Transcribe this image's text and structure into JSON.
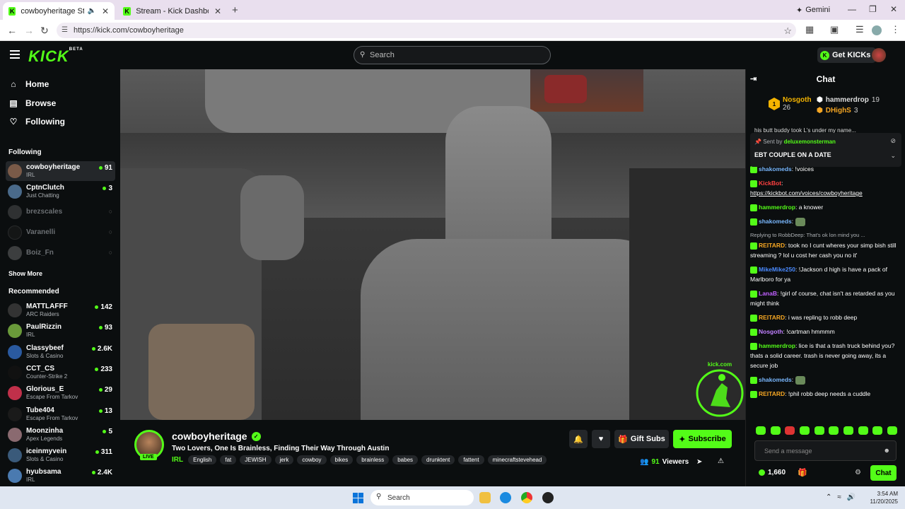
{
  "browser": {
    "tabs": [
      {
        "title": "cowboyheritage Stream - V",
        "active": true,
        "sound_icon": "speaker-icon"
      },
      {
        "title": "Stream - Kick Dashboard",
        "active": false
      }
    ],
    "new_tab": "+",
    "gemini_label": "Gemini",
    "url": "https://kick.com/cowboyheritage"
  },
  "kick": {
    "logo": "KICK",
    "logo_badge": "BETA",
    "search_placeholder": "Search",
    "get_kicks_label": "Get KICKs",
    "accent": "#53fc18"
  },
  "sidebar": {
    "nav": [
      {
        "label": "Home",
        "icon": "home-icon"
      },
      {
        "label": "Browse",
        "icon": "browse-icon"
      },
      {
        "label": "Following",
        "icon": "heart-icon"
      }
    ],
    "following_heading": "Following",
    "following": [
      {
        "name": "cowboyheritage",
        "category": "IRL",
        "viewers": "91",
        "live": true,
        "selected": true,
        "color": "#7a5a48"
      },
      {
        "name": "CptnClutch",
        "category": "Just Chatting",
        "viewers": "3",
        "live": true,
        "color": "#4a6a8a"
      },
      {
        "name": "brezscales",
        "live": false,
        "color": "#666"
      },
      {
        "name": "Varanelli",
        "live": false,
        "color": "#222"
      },
      {
        "name": "Boiz_Fn",
        "live": false,
        "color": "#888"
      }
    ],
    "show_more": "Show More",
    "recommended_heading": "Recommended",
    "recommended": [
      {
        "name": "MATTLAFFF",
        "category": "ARC Raiders",
        "viewers": "142",
        "color": "#333"
      },
      {
        "name": "PaulRizzin",
        "category": "IRL",
        "viewers": "93",
        "color": "#6a9a3a"
      },
      {
        "name": "Classybeef",
        "category": "Slots & Casino",
        "viewers": "2.6K",
        "color": "#2a5aa0"
      },
      {
        "name": "CCT_CS",
        "category": "Counter-Strike 2",
        "viewers": "233",
        "color": "#111"
      },
      {
        "name": "Glorious_E",
        "category": "Escape From Tarkov",
        "viewers": "29",
        "color": "#c0304a"
      },
      {
        "name": "Tube404",
        "category": "Escape From Tarkov",
        "viewers": "13",
        "color": "#1a1a1a"
      },
      {
        "name": "Moonzinha",
        "category": "Apex Legends",
        "viewers": "5",
        "color": "#8a6a70"
      },
      {
        "name": "iceinmyvein",
        "category": "Slots & Casino",
        "viewers": "311",
        "color": "#3a5a7a"
      },
      {
        "name": "hyubsama",
        "category": "IRL",
        "viewers": "2.4K",
        "color": "#4a7ab0"
      }
    ]
  },
  "stream": {
    "watermark_text": "kick.com",
    "streamer": "cowboyheritage",
    "live_badge": "LIVE",
    "title": "Two Lovers, One Is Brainless, Finding Their Way Through Austin",
    "category": "IRL",
    "tags": [
      "English",
      "fat",
      "JEWISH",
      "jerk",
      "cowboy",
      "bikes",
      "brainless",
      "babes",
      "drunktent",
      "fattent",
      "minecraftstevehead"
    ],
    "gift_subs_label": "Gift Subs",
    "subscribe_label": "Subscribe",
    "viewers": "91",
    "viewers_label": "Viewers"
  },
  "chat": {
    "title": "Chat",
    "leaderboard": [
      {
        "name": "Nosgoth",
        "count": "26",
        "rank": "1",
        "color": "#f5b400"
      },
      {
        "name": "hammerdrop",
        "count": "19",
        "color": "#ddd"
      },
      {
        "name": "DHighS",
        "count": "3",
        "color": "#f5a623"
      }
    ],
    "cutoff_line": "his butt buddy took L's under my name...",
    "pinned": {
      "sent_by_prefix": "Sent by",
      "sent_by": "deluxemonsterman",
      "message": "EBT COUPLE ON A DATE"
    },
    "messages": [
      {
        "user": "shakomeds",
        "color": "#7ab8ff",
        "text": "!voices"
      },
      {
        "user": "KickBot",
        "color": "#ff4040",
        "text": "",
        "link": "https://kickbot.com/voices/cowboyheritage"
      },
      {
        "user": "hammerdrop",
        "color": "#53fc18",
        "text": "a knower"
      },
      {
        "user": "shakomeds",
        "color": "#7ab8ff",
        "text": "",
        "emote": true
      },
      {
        "reply": "Replying to RobbDeep: That's ok lon mind you ...",
        "user": "REITARD",
        "color": "#f5a623",
        "text": "took no I cunt wheres your simp bish still streaming ? lol u cost her cash you no it'"
      },
      {
        "user": "MikeMike250",
        "color": "#4a8aff",
        "text": "!Jackson d high is have a pack of Marlboro for ya"
      },
      {
        "user": "LanaB",
        "color": "#c060ff",
        "text": "!girl of course, chat isn't as retarded as you might think"
      },
      {
        "user": "REITARD",
        "color": "#f5a623",
        "text": "i was repling to robb deep"
      },
      {
        "user": "Nosgoth",
        "color": "#c080ff",
        "text": "!cartman hmmmm"
      },
      {
        "user": "hammerdrop",
        "color": "#53fc18",
        "text": "lice is that a trash truck behind you? thats a solid career. trash is never going away, its a secure job"
      },
      {
        "user": "shakomeds",
        "color": "#7ab8ff",
        "text": "",
        "emote": true
      },
      {
        "user": "REITARD",
        "color": "#f5a623",
        "text": "!phil robb deep needs a cuddle"
      }
    ],
    "send_placeholder": "Send a message",
    "kicks_balance": "1,660",
    "chat_button": "Chat"
  },
  "taskbar": {
    "search_placeholder": "Search",
    "time": "3:54 AM",
    "date": "11/20/2025"
  }
}
